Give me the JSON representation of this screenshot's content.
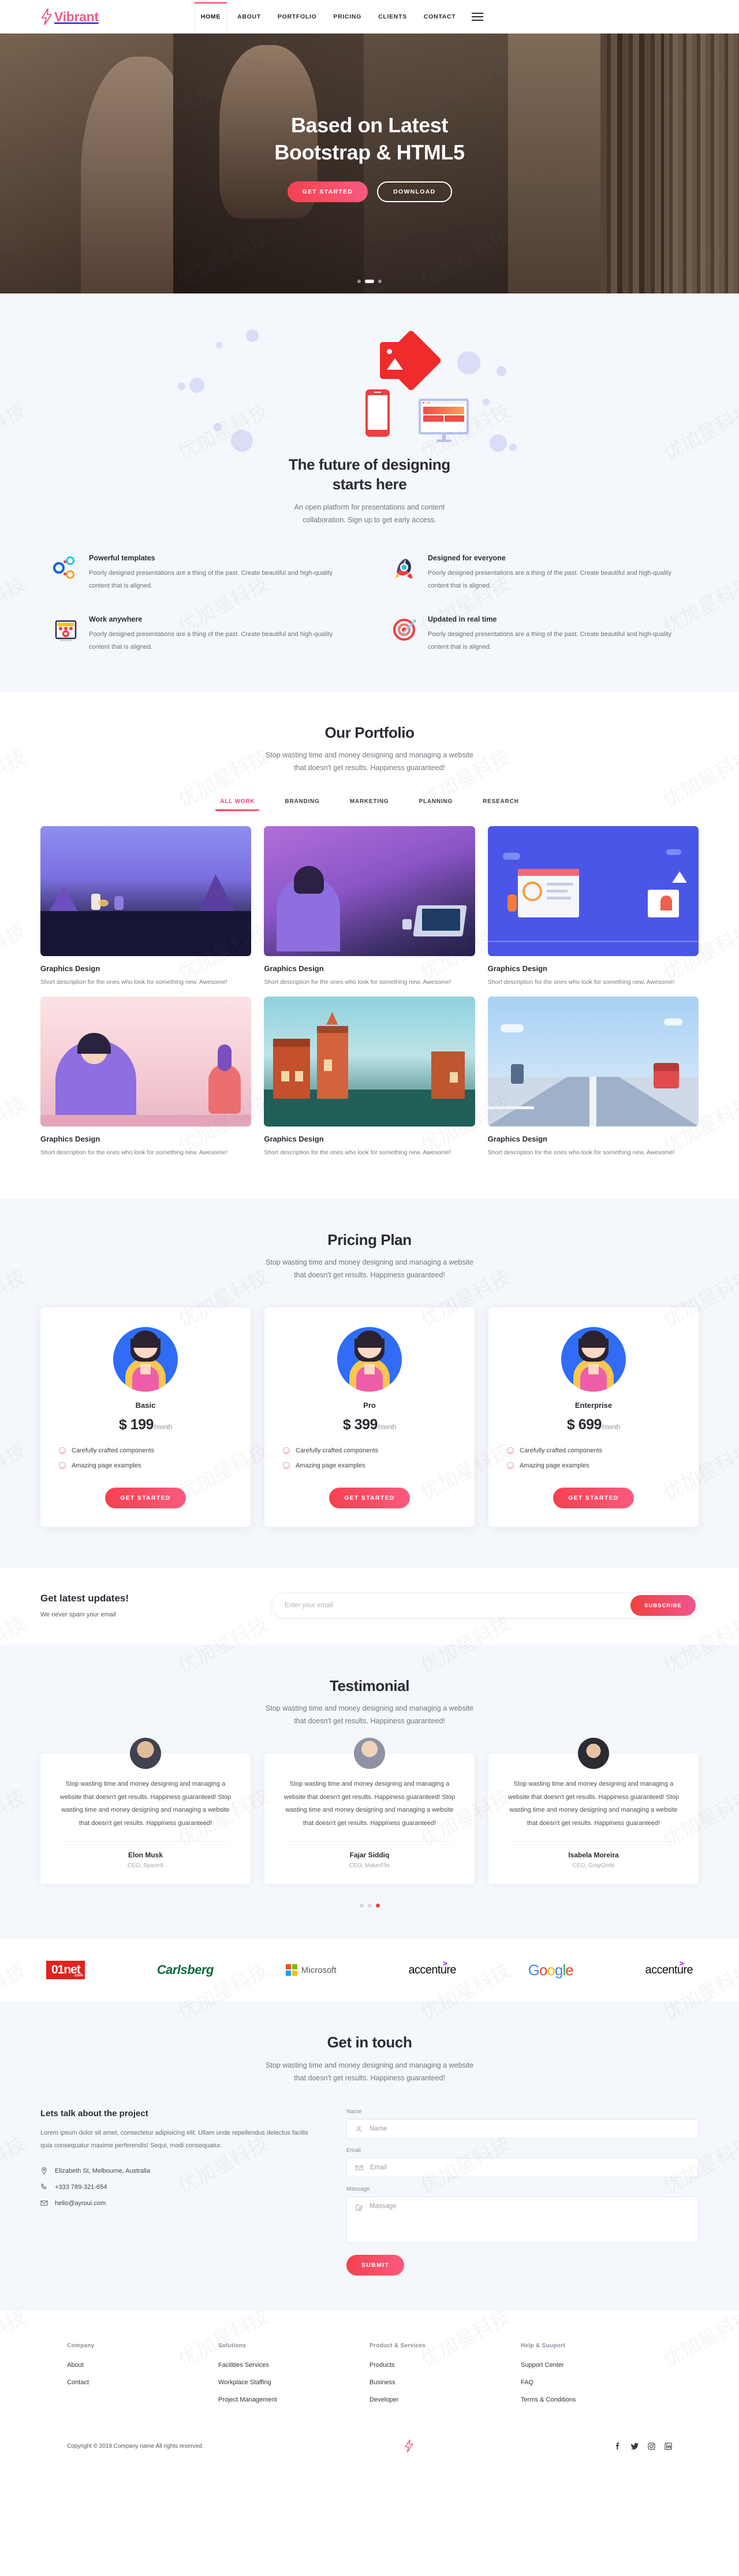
{
  "header": {
    "brand": "Vibrant",
    "brand_icon": "lightning-bolt-icon",
    "nav": [
      {
        "label": "HOME",
        "active": true
      },
      {
        "label": "ABOUT",
        "active": false
      },
      {
        "label": "PORTFOLIO",
        "active": false
      },
      {
        "label": "PRICING",
        "active": false
      },
      {
        "label": "CLIENTS",
        "active": false
      },
      {
        "label": "CONTACT",
        "active": false
      }
    ],
    "menu_icon": "hamburger-menu-icon"
  },
  "hero": {
    "title_line1": "Based on Latest",
    "title_line2": "Bootstrap & HTML5",
    "primary_button": "GET STARTED",
    "secondary_button": "DOWNLOAD",
    "slides": 3,
    "active_slide": 1
  },
  "features": {
    "title_line1": "The future of designing",
    "title_line2": "starts here",
    "subtitle_line1": "An open platform for presentations and content",
    "subtitle_line2": "collaboration. Sign up to get early access.",
    "items": [
      {
        "icon": "connected-circles-icon",
        "title": "Powerful templates",
        "text": "Poorly designed presentations are a thing of the past. Create beautiful and high-quality content that is aligned."
      },
      {
        "icon": "rocket-icon",
        "title": "Designed for everyone",
        "text": "Poorly designed presentations are a thing of the past. Create beautiful and high-quality content that is aligned."
      },
      {
        "icon": "storefront-icon",
        "title": "Work anywhere",
        "text": "Poorly designed presentations are a thing of the past. Create beautiful and high-quality content that is aligned."
      },
      {
        "icon": "target-dart-icon",
        "title": "Updated in real time",
        "text": "Poorly designed presentations are a thing of the past. Create beautiful and high-quality content that is aligned."
      }
    ]
  },
  "portfolio": {
    "title": "Our Portfolio",
    "subtitle_line1": "Stop wasting time and money designing and managing a website",
    "subtitle_line2": "that doesn't get results. Happiness guaranteed!",
    "filters": [
      {
        "label": "ALL WORK",
        "active": true
      },
      {
        "label": "BRANDING",
        "active": false
      },
      {
        "label": "MARKETING",
        "active": false
      },
      {
        "label": "PLANNING",
        "active": false
      },
      {
        "label": "RESEARCH",
        "active": false
      }
    ],
    "items": [
      {
        "title": "Graphics Design",
        "desc": "Short description for the ones who look for something new. Awesome!"
      },
      {
        "title": "Graphics Design",
        "desc": "Short description for the ones who look for something new. Awesome!"
      },
      {
        "title": "Graphics Design",
        "desc": "Short description for the ones who look for something new. Awesome!"
      },
      {
        "title": "Graphics Design",
        "desc": "Short description for the ones who look for something new. Awesome!"
      },
      {
        "title": "Graphics Design",
        "desc": "Short description for the ones who look for something new. Awesome!"
      },
      {
        "title": "Graphics Design",
        "desc": "Short description for the ones who look for something new. Awesome!"
      }
    ]
  },
  "pricing": {
    "title": "Pricing Plan",
    "subtitle_line1": "Stop wasting time and money designing and managing a website",
    "subtitle_line2": "that doesn't get results. Happiness guaranteed!",
    "plans": [
      {
        "name": "Basic",
        "price": "$ 199",
        "period": "/month",
        "features": [
          "Carefully crafted components",
          "Amazing page examples"
        ],
        "cta": "GET STARTED"
      },
      {
        "name": "Pro",
        "price": "$ 399",
        "period": "/month",
        "features": [
          "Carefully crafted components",
          "Amazing page examples"
        ],
        "cta": "GET STARTED"
      },
      {
        "name": "Enterprise",
        "price": "$ 699",
        "period": "/month",
        "features": [
          "Carefully crafted components",
          "Amazing page examples"
        ],
        "cta": "GET STARTED"
      }
    ]
  },
  "newsletter": {
    "title": "Get latest updates!",
    "note": "We never spam your email",
    "placeholder": "Enter your email",
    "value": "",
    "button": "SUBSCRIBE"
  },
  "testimonial": {
    "title": "Testimonial",
    "subtitle_line1": "Stop wasting time and money designing and managing a website",
    "subtitle_line2": "that doesn't get results. Happiness guaranteed!",
    "items": [
      {
        "text": "Stop wasting time and money designing and managing a website that doesn't get results. Happiness guaranteed! Stop wasting time and money designing and managing a website that doesn't get results. Happiness guaranteed!",
        "name": "Elon Musk",
        "role": "CEO, SpaceX"
      },
      {
        "text": "Stop wasting time and money designing and managing a website that doesn't get results. Happiness guaranteed! Stop wasting time and money designing and managing a website that doesn't get results. Happiness guaranteed!",
        "name": "Fajar Siddiq",
        "role": "CEO, MakerFlix"
      },
      {
        "text": "Stop wasting time and money designing and managing a website that doesn't get results. Happiness guaranteed! Stop wasting time and money designing and managing a website that doesn't get results. Happiness guaranteed!",
        "name": "Isabela Moreira",
        "role": "CEO, GrayGrids"
      }
    ],
    "dots": 3,
    "active_dot": 3
  },
  "brands": [
    {
      "name": "01net.com",
      "icon": "01net-logo"
    },
    {
      "name": "Carlsberg",
      "icon": "carlsberg-logo"
    },
    {
      "name": "Microsoft",
      "icon": "microsoft-logo"
    },
    {
      "name": "accenture",
      "icon": "accenture-logo"
    },
    {
      "name": "Google",
      "icon": "google-logo"
    },
    {
      "name": "accenture",
      "icon": "accenture-logo"
    }
  ],
  "contact": {
    "title": "Get in touch",
    "subtitle_line1": "Stop wasting time and money designing and managing a website",
    "subtitle_line2": "that doesn't get results. Happiness guaranteed!",
    "left_heading": "Lets talk about the project",
    "left_text": "Lorem ipsum dolor sit amet, consectetur adipisicing elit. Ullam unde repellendus delectus facilis quia consequatur maxime perferendis! Sequi, modi consequatur.",
    "address": "Elizabeth St, Melbourne, Australia",
    "phone": "+333 789-321-654",
    "email": "hello@ayroui.com",
    "form": {
      "name_label": "Name",
      "name_placeholder": "Name",
      "name_value": "",
      "email_label": "Email",
      "email_placeholder": "Email",
      "email_value": "",
      "message_label": "Massage",
      "message_placeholder": "Massage",
      "message_value": "",
      "submit": "SUBMIT"
    }
  },
  "footer": {
    "columns": [
      {
        "heading": "Company",
        "links": [
          "About",
          "Contact"
        ]
      },
      {
        "heading": "Solutions",
        "links": [
          "Facilities Services",
          "Workplace Staffing",
          "Project Management"
        ]
      },
      {
        "heading": "Product & Services",
        "links": [
          "Products",
          "Business",
          "Developer"
        ]
      },
      {
        "heading": "Help & Suuport",
        "links": [
          "Support Center",
          "FAQ",
          "Terms & Conditions"
        ]
      }
    ],
    "copyright": "Copyright © 2019.Company name All rights reserved.",
    "social": [
      "facebook-icon",
      "twitter-icon",
      "instagram-icon",
      "linkedin-icon"
    ]
  },
  "watermark": "优加星科技"
}
